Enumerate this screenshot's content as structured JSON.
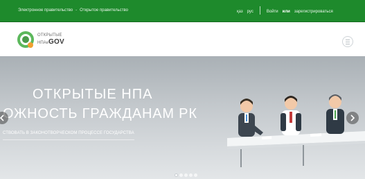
{
  "topbar": {
    "egov_link": "Электронное правительство",
    "separator": "-",
    "open_gov_link": "Открытое правительство",
    "lang_kaz": "қаз",
    "lang_rus": "рус",
    "login": "Войти",
    "or": "или",
    "register": "зарегистрироваться"
  },
  "logo": {
    "line1": "ОТКРЫТЫЕ",
    "line2_prefix": "НПА",
    "line2_mid": "e",
    "line2_suffix": "GOV"
  },
  "hero": {
    "title": "ОТКРЫТЫЕ НПА",
    "subtitle": "ОЖНОСТЬ ГРАЖДАНАМ РК",
    "caption": "СТВОВАТЬ В ЗАКОНОТВОРЧЕСКОМ ПРОЦЕССЕ ГОСУДАРСТВА"
  },
  "slider": {
    "slide_count": 5,
    "active_index": 0
  },
  "colors": {
    "brand_green": "#1e8a2c",
    "logo_green": "#5cb85c",
    "logo_orange": "#f0a030"
  },
  "icons": {
    "menu": "hamburger-icon",
    "prev": "chevron-left-icon",
    "next": "chevron-right-icon"
  }
}
